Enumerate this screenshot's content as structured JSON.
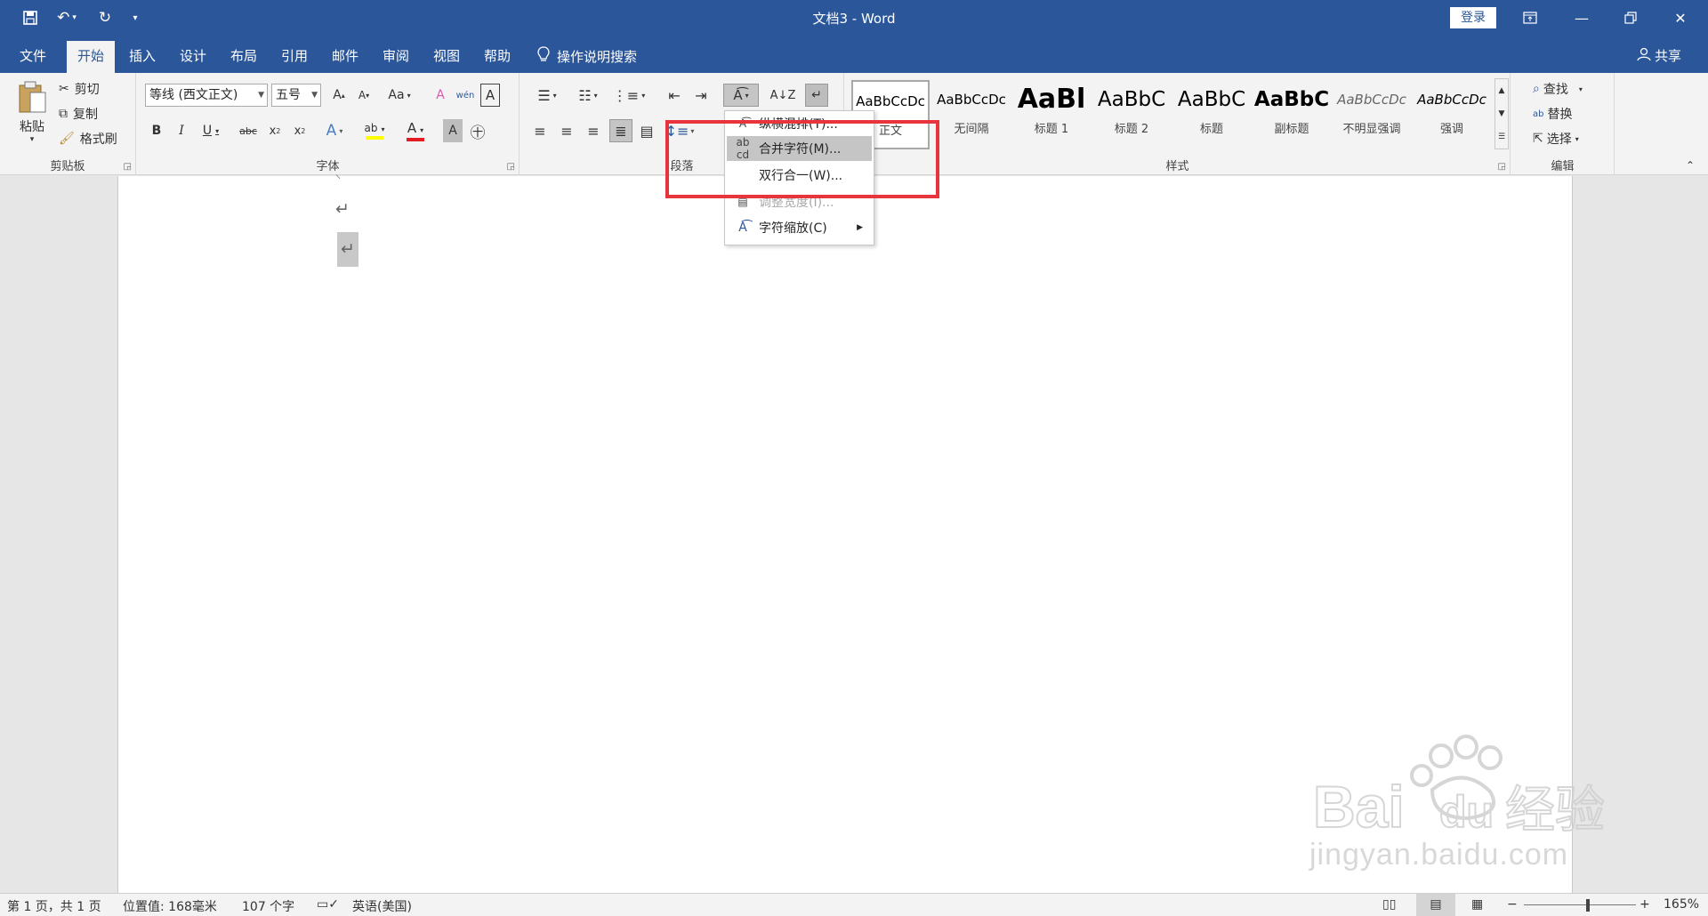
{
  "titlebar": {
    "title": "文档3 - Word",
    "login_label": "登录",
    "save_icon": "save-icon",
    "undo_icon": "undo-icon",
    "redo_icon": "redo-icon"
  },
  "tabs": [
    "文件",
    "开始",
    "插入",
    "设计",
    "布局",
    "引用",
    "邮件",
    "审阅",
    "视图",
    "帮助"
  ],
  "active_tab": "开始",
  "tell_me": "操作说明搜索",
  "share_label": "共享",
  "clipboard": {
    "paste": "粘贴",
    "cut": "剪切",
    "copy": "复制",
    "format_painter": "格式刷",
    "group_label": "剪贴板"
  },
  "font": {
    "family": "等线 (西文正文)",
    "size": "五号",
    "group_label": "字体"
  },
  "paragraph": {
    "group_label": "段落"
  },
  "styles": {
    "group_label": "样式",
    "items": [
      {
        "preview": "AaBbCcDc",
        "name": "正文"
      },
      {
        "preview": "AaBbCcDc",
        "name": "无间隔"
      },
      {
        "preview": "AaBl",
        "name": "标题 1"
      },
      {
        "preview": "AaBbC",
        "name": "标题 2"
      },
      {
        "preview": "AaBbC",
        "name": "标题"
      },
      {
        "preview": "AaBbC",
        "name": "副标题"
      },
      {
        "preview": "AaBbCcDc",
        "name": "不明显强调"
      },
      {
        "preview": "AaBbCcDc",
        "name": "强调"
      }
    ]
  },
  "editing": {
    "find": "查找",
    "replace": "替换",
    "select": "选择",
    "group_label": "编辑"
  },
  "dropdown": {
    "items": [
      {
        "label": "纵横混排(T)...",
        "state": "normal"
      },
      {
        "label": "合并字符(M)...",
        "state": "hover"
      },
      {
        "label": "双行合一(W)...",
        "state": "normal"
      },
      {
        "label": "调整宽度(I)...",
        "state": "disabled"
      },
      {
        "label": "字符缩放(C)",
        "state": "normal",
        "submenu": true
      }
    ]
  },
  "document": {
    "paragraph_mark": "↵"
  },
  "statusbar": {
    "page": "第 1 页，共 1 页",
    "position": "位置值: 168毫米",
    "words": "107 个字",
    "language": "英语(美国)",
    "zoom": "165%"
  },
  "watermark": {
    "brand": "Bai du 经验",
    "url": "jingyan.baidu.com"
  },
  "colors": {
    "brand_blue": "#2b579a",
    "highlight_red": "#e8343c",
    "font_color_red": "#e31b23",
    "highlight_yellow": "#ffff00"
  }
}
